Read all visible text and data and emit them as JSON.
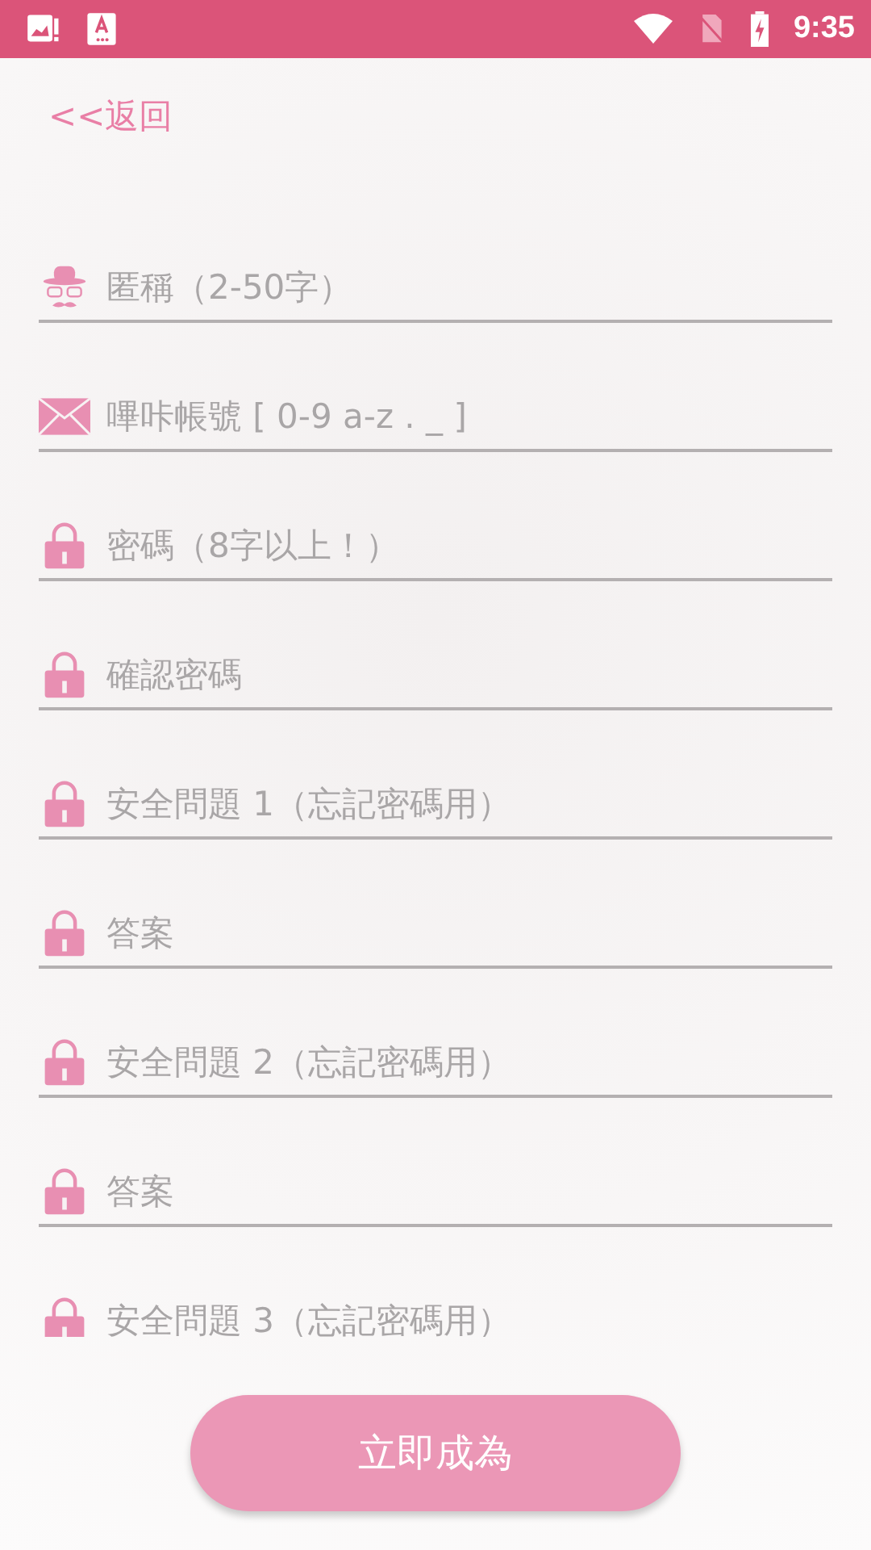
{
  "status_bar": {
    "time": "9:35"
  },
  "back_link": "<<返回",
  "fields": [
    {
      "kind": "hat",
      "placeholder": "匿稱（2-50字）"
    },
    {
      "kind": "mail",
      "placeholder": "嗶咔帳號 [ 0-9 a-z . _ ]"
    },
    {
      "kind": "lock",
      "placeholder": "密碼（8字以上！）"
    },
    {
      "kind": "lock",
      "placeholder": "確認密碼"
    },
    {
      "kind": "lock",
      "placeholder": "安全問題 1（忘記密碼用）"
    },
    {
      "kind": "lock",
      "placeholder": "答案"
    },
    {
      "kind": "lock",
      "placeholder": "安全問題 2（忘記密碼用）"
    },
    {
      "kind": "lock",
      "placeholder": "答案"
    },
    {
      "kind": "lock",
      "placeholder": "安全問題 3（忘記密碼用）"
    }
  ],
  "submit_button": "立即成為"
}
